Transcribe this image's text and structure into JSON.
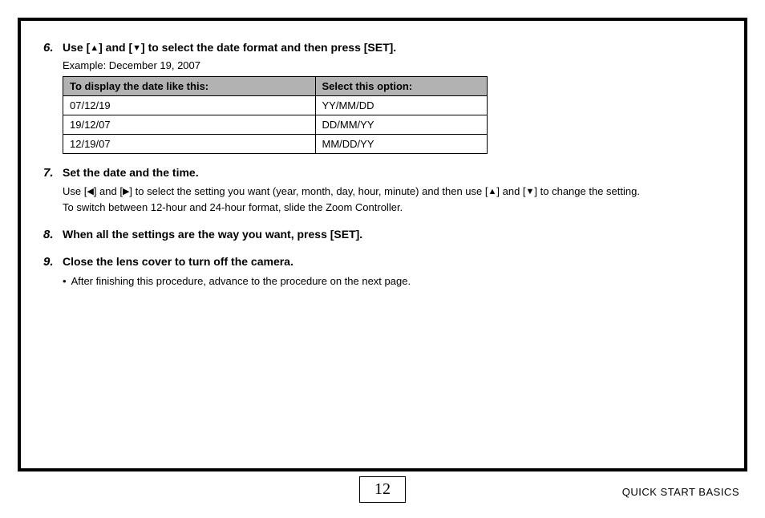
{
  "steps": {
    "s6": {
      "num": "6.",
      "title_parts": [
        "Use [",
        "▲",
        "] and [",
        "▼",
        "] to select the date format and then press [SET]."
      ],
      "example": "Example: December 19, 2007",
      "table": {
        "h1": "To display the date like this:",
        "h2": "Select this option:",
        "rows": [
          {
            "c1": "07/12/19",
            "c2": "YY/MM/DD"
          },
          {
            "c1": "19/12/07",
            "c2": "DD/MM/YY"
          },
          {
            "c1": "12/19/07",
            "c2": "MM/DD/YY"
          }
        ]
      }
    },
    "s7": {
      "num": "7.",
      "title": "Set the date and the time.",
      "body_parts": [
        "Use [",
        "◀",
        "] and [",
        "▶",
        "] to select the setting you want (year, month, day, hour, minute) and then use [",
        "▲",
        "] and [",
        "▼",
        "] to change the setting."
      ],
      "body_line2": "To switch between 12-hour and 24-hour format, slide the Zoom Controller."
    },
    "s8": {
      "num": "8.",
      "title": "When all the settings are the way you want, press [SET]."
    },
    "s9": {
      "num": "9.",
      "title": "Close the lens cover to turn off the camera.",
      "bullet": "After finishing this procedure, advance to the procedure on the next page."
    }
  },
  "footer": {
    "page": "12",
    "label": "QUICK START BASICS"
  }
}
